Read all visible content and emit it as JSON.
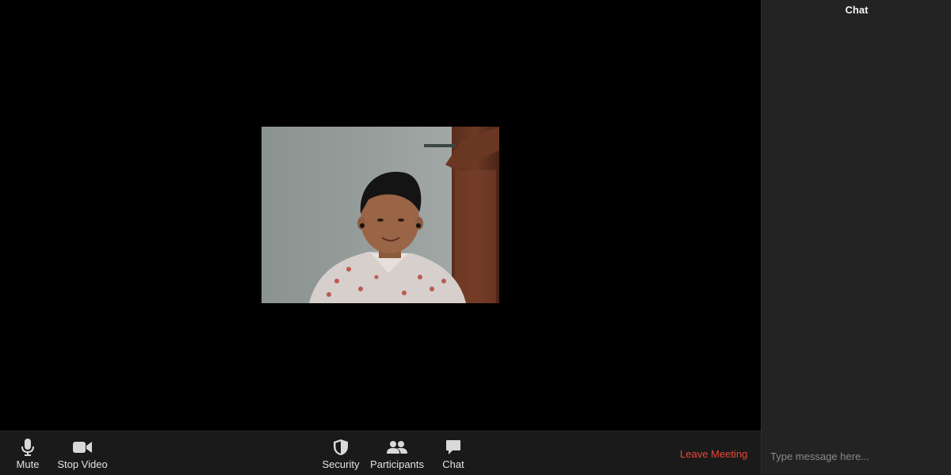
{
  "video": {
    "participant_tile": "camera-video-feed"
  },
  "toolbar": {
    "mute_label": "Mute",
    "stop_video_label": "Stop Video",
    "security_label": "Security",
    "participants_label": "Participants",
    "chat_label": "Chat",
    "leave_label": "Leave Meeting"
  },
  "chat": {
    "title": "Chat",
    "input_placeholder": "Type message here..."
  },
  "icons": {
    "mute": "microphone-icon",
    "stop_video": "video-camera-icon",
    "security": "shield-icon",
    "participants": "people-icon",
    "chat": "chat-bubble-icon"
  },
  "colors": {
    "leave": "#e8473a",
    "toolbar_bg": "#1a1a1a",
    "chat_bg": "#232323"
  }
}
